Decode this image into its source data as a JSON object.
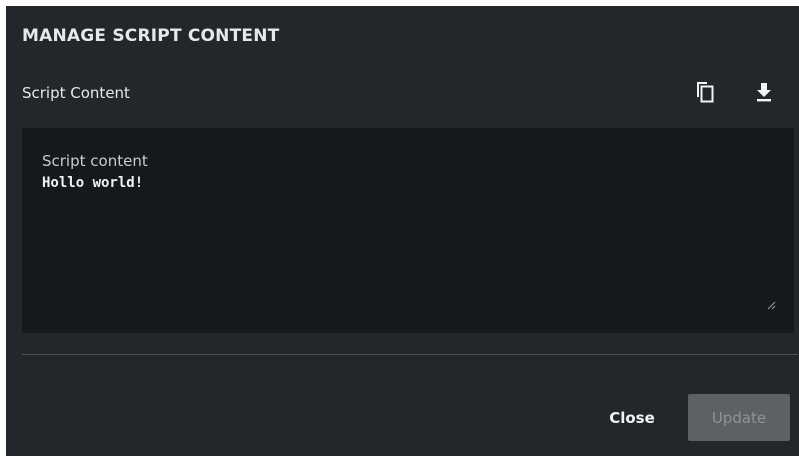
{
  "dialog": {
    "title": "MANAGE SCRIPT CONTENT",
    "section_label": "Script Content",
    "icons": {
      "copy": "copy-icon",
      "download": "download-icon"
    },
    "editor": {
      "label": "Script content",
      "value": "Hollo world!"
    },
    "buttons": {
      "close_label": "Close",
      "update_label": "Update",
      "update_disabled": true
    }
  },
  "colors": {
    "dialog_bg": "#23272b",
    "editor_bg": "#15191c",
    "text": "#e6e8ea",
    "disabled_button_bg": "#5d6064",
    "disabled_button_text": "#8f9397"
  }
}
